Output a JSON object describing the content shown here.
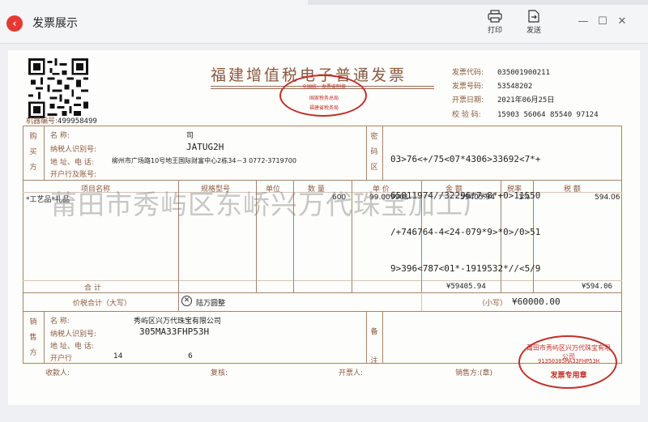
{
  "window": {
    "title": "发票展示",
    "print_label": "打印",
    "send_label": "发送"
  },
  "invoice": {
    "title": "福建增值税电子普通发票",
    "code_label": "发票代码:",
    "code": "035001900211",
    "number_label": "发票号码:",
    "number": "53548202",
    "date_label": "开票日期:",
    "date": "2021年06月25日",
    "check_label": "校 验 码:",
    "check_code": "15903 56064 85540 97124",
    "machine_label": "机器编号:",
    "machine_no": "499958499",
    "seal_text_1": "全国统一发票监制章",
    "seal_text_2": "国家税务总局",
    "seal_text_3": "福建省税务局"
  },
  "buyer": {
    "section": [
      "购",
      "买",
      "方"
    ],
    "name_label": "名         称:",
    "name": "司",
    "tax_id_label": "纳税人识别号:",
    "tax_id": "JATUG2H",
    "address_label": "地 址、电 话:",
    "address": "柳州市广场路10号地王国际财富中心2栋34－3 0772-3719700",
    "bank_label": "开户行及账号:"
  },
  "cipher": {
    "section": [
      "密",
      "码",
      "区"
    ],
    "lines": [
      "03>76<+/75<07*4306>33692<7*+",
      "65811974//32296*7<8*+0>11550",
      "/+746764-4<24-079*9>*0>/0>51",
      "9>396<787<01*-1919532*//<5/9"
    ]
  },
  "items": {
    "headers": {
      "name": "项目名称",
      "spec": "规格型号",
      "unit": "单位",
      "qty": "数  量",
      "price": "单  价",
      "amount": "金  额",
      "rate": "税率",
      "tax": "税  额"
    },
    "rows": [
      {
        "name": "*工艺品*礼品",
        "spec": "",
        "unit": "",
        "qty": "600",
        "price": "99.009901",
        "amount": "59405.94",
        "rate": "1%",
        "tax": "594.06"
      }
    ],
    "subtotal_label": "合    计",
    "subtotal_amount": "¥59405.94",
    "subtotal_tax": "¥594.06"
  },
  "total": {
    "label": "价税合计（大写）",
    "words": "陆万圆整",
    "small_label": "（小写）",
    "small": "¥60000.00"
  },
  "seller": {
    "section": [
      "销",
      "售",
      "方"
    ],
    "name_label": "名         称:",
    "name": "秀屿区兴万代珠宝有限公司",
    "tax_id_label": "纳税人识别号:",
    "tax_id": "305MA33FHP53H",
    "address_label": "地 址、电 话:",
    "bank_label": "开户行",
    "bank_partial_1": "14",
    "bank_partial_2": "6",
    "remark": [
      "备",
      "注"
    ]
  },
  "footer": {
    "payee": "收款人:",
    "reviewer": "复核:",
    "issuer": "开票人:",
    "seller_sign": "销售方:(章)"
  },
  "seller_seal": {
    "name": "莆田市秀屿区兴万代珠宝有限公司",
    "tax_id": "91350305MA33FHP53H",
    "label": "发票专用章"
  },
  "watermark": "莆田市秀屿区东峤兴万代珠宝加工厂",
  "colors": {
    "frame": "#a88468",
    "label": "#8a5a3e",
    "seal": "#c0302a",
    "close_button": "#e53935"
  }
}
